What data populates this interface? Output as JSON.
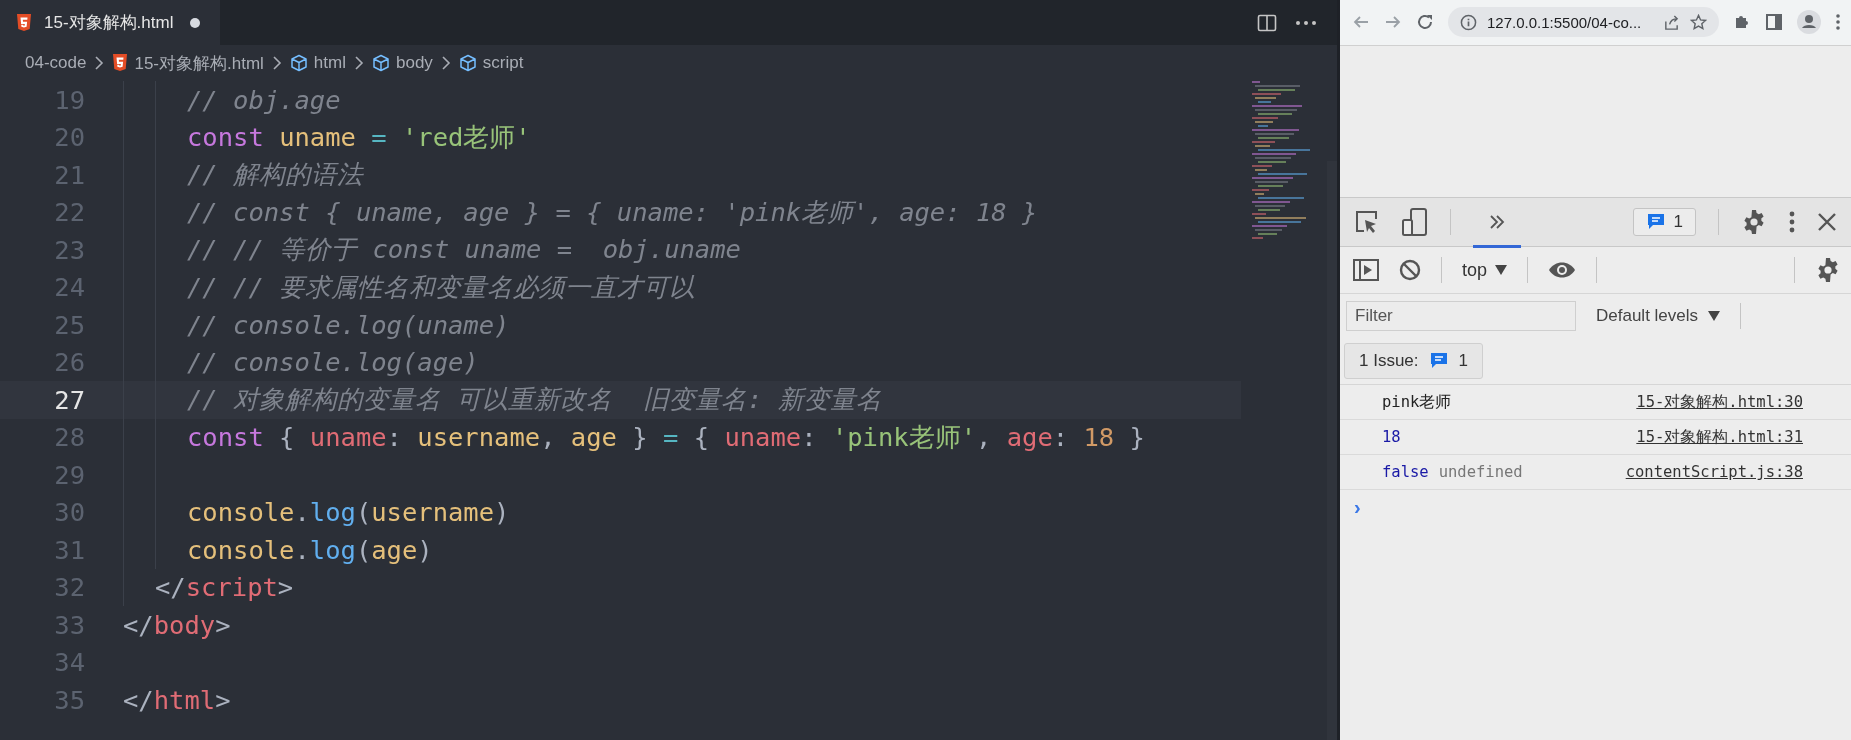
{
  "editor": {
    "tab": {
      "label": "15-对象解构.html",
      "modified": true
    },
    "breadcrumb": [
      {
        "label": "04-code",
        "kind": "folder"
      },
      {
        "label": "15-对象解构.html",
        "kind": "html-file"
      },
      {
        "label": "html",
        "kind": "symbol"
      },
      {
        "label": "body",
        "kind": "symbol"
      },
      {
        "label": "script",
        "kind": "symbol"
      }
    ],
    "lines": [
      {
        "number": "19",
        "kind": "script",
        "current": false,
        "tokens": [
          {
            "text": "// obj.age",
            "kind": "comment"
          }
        ]
      },
      {
        "number": "20",
        "kind": "script",
        "current": false,
        "tokens": [
          {
            "text": "const ",
            "kind": "keyword"
          },
          {
            "text": "uname",
            "kind": "variable"
          },
          {
            "text": " = ",
            "kind": "operator"
          },
          {
            "text": "'red老师'",
            "kind": "string"
          }
        ]
      },
      {
        "number": "21",
        "kind": "script",
        "current": false,
        "tokens": [
          {
            "text": "// 解构的语法",
            "kind": "comment"
          }
        ]
      },
      {
        "number": "22",
        "kind": "script",
        "current": false,
        "tokens": [
          {
            "text": "// const { uname, age } = { uname: 'pink老师', age: 18 }",
            "kind": "comment"
          }
        ]
      },
      {
        "number": "23",
        "kind": "script",
        "current": false,
        "tokens": [
          {
            "text": "// // 等价于 const uname =  obj.uname",
            "kind": "comment"
          }
        ]
      },
      {
        "number": "24",
        "kind": "script",
        "current": false,
        "tokens": [
          {
            "text": "// // 要求属性名和变量名必须一直才可以",
            "kind": "comment"
          }
        ]
      },
      {
        "number": "25",
        "kind": "script",
        "current": false,
        "tokens": [
          {
            "text": "// console.log(uname)",
            "kind": "comment"
          }
        ]
      },
      {
        "number": "26",
        "kind": "script",
        "current": false,
        "tokens": [
          {
            "text": "// console.log(age)",
            "kind": "comment"
          }
        ]
      },
      {
        "number": "27",
        "kind": "script",
        "current": true,
        "tokens": [
          {
            "text": "// 对象解构的变量名 可以重新改名  旧变量名: 新变量名",
            "kind": "comment"
          }
        ]
      },
      {
        "number": "28",
        "kind": "script",
        "current": false,
        "tokens": [
          {
            "text": "const",
            "kind": "keyword"
          },
          {
            "text": " { ",
            "kind": "punct"
          },
          {
            "text": "uname",
            "kind": "property"
          },
          {
            "text": ": ",
            "kind": "punct"
          },
          {
            "text": "username",
            "kind": "variable"
          },
          {
            "text": ", ",
            "kind": "punct"
          },
          {
            "text": "age",
            "kind": "variable"
          },
          {
            "text": " } ",
            "kind": "punct"
          },
          {
            "text": "=",
            "kind": "operator"
          },
          {
            "text": " { ",
            "kind": "punct"
          },
          {
            "text": "uname",
            "kind": "property"
          },
          {
            "text": ": ",
            "kind": "punct"
          },
          {
            "text": "'pink老师'",
            "kind": "string"
          },
          {
            "text": ", ",
            "kind": "punct"
          },
          {
            "text": "age",
            "kind": "property"
          },
          {
            "text": ": ",
            "kind": "punct"
          },
          {
            "text": "18",
            "kind": "number"
          },
          {
            "text": " }",
            "kind": "punct"
          }
        ]
      },
      {
        "number": "29",
        "kind": "script",
        "current": false
      },
      {
        "number": "30",
        "kind": "script",
        "current": false,
        "tokens": [
          {
            "text": "console",
            "kind": "variable"
          },
          {
            "text": ".",
            "kind": "punct"
          },
          {
            "text": "log",
            "kind": "function"
          },
          {
            "text": "(",
            "kind": "punct"
          },
          {
            "text": "username",
            "kind": "variable"
          },
          {
            "text": ")",
            "kind": "punct"
          }
        ]
      },
      {
        "number": "31",
        "kind": "script",
        "current": false,
        "tokens": [
          {
            "text": "console",
            "kind": "variable"
          },
          {
            "text": ".",
            "kind": "punct"
          },
          {
            "text": "log",
            "kind": "function"
          },
          {
            "text": "(",
            "kind": "punct"
          },
          {
            "text": "age",
            "kind": "variable"
          },
          {
            "text": ")",
            "kind": "punct"
          }
        ]
      },
      {
        "number": "32",
        "kind": "body",
        "current": false,
        "tokens": [
          {
            "text": "</",
            "kind": "punct"
          },
          {
            "text": "script",
            "kind": "tag"
          },
          {
            "text": ">",
            "kind": "punct"
          }
        ]
      },
      {
        "number": "33",
        "kind": "html",
        "current": false,
        "tokens": [
          {
            "text": "</",
            "kind": "punct"
          },
          {
            "text": "body",
            "kind": "tag"
          },
          {
            "text": ">",
            "kind": "punct"
          }
        ]
      },
      {
        "number": "34",
        "kind": "html",
        "current": false
      },
      {
        "number": "35",
        "kind": "html",
        "current": false,
        "tokens": [
          {
            "text": "</",
            "kind": "punct"
          },
          {
            "text": "html",
            "kind": "tag"
          },
          {
            "text": ">",
            "kind": "punct"
          }
        ]
      }
    ]
  },
  "browser": {
    "address": "127.0.0.1:5500/04-co...",
    "devtools": {
      "overflow_tab": {
        "selected": true
      },
      "issue_count": "1",
      "context": "top",
      "filter": {
        "placeholder": "Filter"
      },
      "levels": "Default levels",
      "issues": {
        "label": "1 Issue:",
        "count": "1"
      },
      "messages": [
        {
          "values": [
            {
              "text": "pink老师",
              "kind": "string"
            }
          ],
          "source": "15-对象解构.html:30"
        },
        {
          "values": [
            {
              "text": "18",
              "kind": "number"
            }
          ],
          "source": "15-对象解构.html:31"
        },
        {
          "values": [
            {
              "text": "false",
              "kind": "boolean"
            },
            {
              "text": "undefined",
              "kind": "undefined"
            }
          ],
          "source": "contentScript.js:38"
        }
      ],
      "prompt": "›"
    }
  }
}
